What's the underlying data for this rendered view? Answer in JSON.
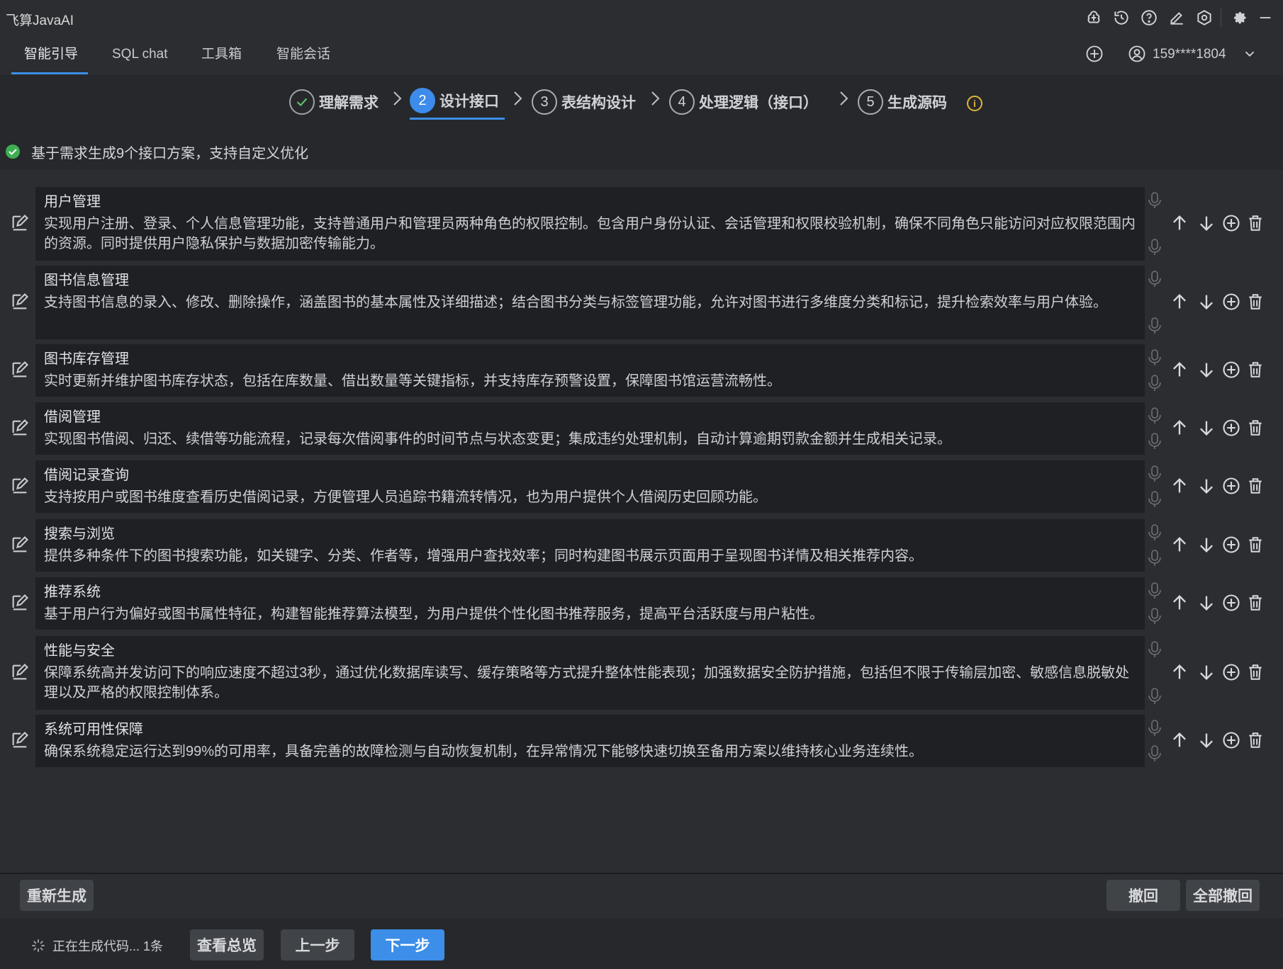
{
  "app": {
    "title": "飞算JavaAI"
  },
  "tabs": [
    {
      "label": "智能引导",
      "active": true
    },
    {
      "label": "SQL chat",
      "active": false
    },
    {
      "label": "工具箱",
      "active": false
    },
    {
      "label": "智能会话",
      "active": false
    }
  ],
  "user": {
    "name": "159****1804"
  },
  "steps": [
    {
      "number": "",
      "label": "理解需求",
      "state": "done"
    },
    {
      "number": "2",
      "label": "设计接口",
      "state": "active"
    },
    {
      "number": "3",
      "label": "表结构设计",
      "state": "pending"
    },
    {
      "number": "4",
      "label": "处理逻辑（接口）",
      "state": "pending"
    },
    {
      "number": "5",
      "label": "生成源码",
      "state": "pending"
    }
  ],
  "info_icon_glyph": "i",
  "summary": {
    "text": "基于需求生成9个接口方案，支持自定义优化"
  },
  "items": [
    {
      "title": "用户管理",
      "desc": "实现用户注册、登录、个人信息管理功能，支持普通用户和管理员两种角色的权限控制。包含用户身份认证、会话管理和权限校验机制，确保不同角色只能访问对应权限范围内的资源。同时提供用户隐私保护与数据加密传输能力。"
    },
    {
      "title": "图书信息管理",
      "desc": "支持图书信息的录入、修改、删除操作，涵盖图书的基本属性及详细描述；结合图书分类与标签管理功能，允许对图书进行多维度分类和标记，提升检索效率与用户体验。"
    },
    {
      "title": "图书库存管理",
      "desc": "实时更新并维护图书库存状态，包括在库数量、借出数量等关键指标，并支持库存预警设置，保障图书馆运营流畅性。"
    },
    {
      "title": "借阅管理",
      "desc": "实现图书借阅、归还、续借等功能流程，记录每次借阅事件的时间节点与状态变更；集成违约处理机制，自动计算逾期罚款金额并生成相关记录。"
    },
    {
      "title": "借阅记录查询",
      "desc": "支持按用户或图书维度查看历史借阅记录，方便管理人员追踪书籍流转情况，也为用户提供个人借阅历史回顾功能。"
    },
    {
      "title": "搜索与浏览",
      "desc": "提供多种条件下的图书搜索功能，如关键字、分类、作者等，增强用户查找效率；同时构建图书展示页面用于呈现图书详情及相关推荐内容。"
    },
    {
      "title": "推荐系统",
      "desc": "基于用户行为偏好或图书属性特征，构建智能推荐算法模型，为用户提供个性化图书推荐服务，提高平台活跃度与用户粘性。"
    },
    {
      "title": "性能与安全",
      "desc": "保障系统高并发访问下的响应速度不超过3秒，通过优化数据库读写、缓存策略等方式提升整体性能表现；加强数据安全防护措施，包括但不限于传输层加密、敏感信息脱敏处理以及严格的权限控制体系。"
    },
    {
      "title": "系统可用性保障",
      "desc": "确保系统稳定运行达到99%的可用率，具备完善的故障检测与自动恢复机制，在异常情况下能够快速切换至备用方案以维持核心业务连续性。"
    }
  ],
  "buttons": {
    "regenerate": "重新生成",
    "undo": "撤回",
    "undo_all": "全部撤回",
    "overview": "查看总览",
    "prev": "上一步",
    "next": "下一步"
  },
  "status": {
    "text": "正在生成代码... 1条"
  },
  "colors": {
    "accent": "#3c8ee8",
    "success": "#3fae53",
    "warning": "#e0b43a",
    "background": "#2b2d30",
    "card": "#1f2023"
  }
}
